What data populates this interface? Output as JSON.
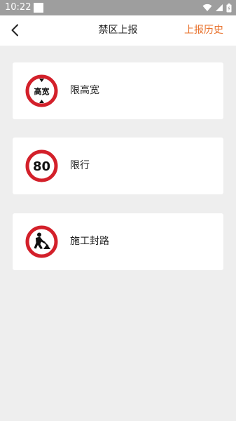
{
  "status_bar": {
    "time": "10:22",
    "icons": [
      "notification-square-icon",
      "wifi-icon",
      "cell-signal-icon",
      "battery-charging-icon"
    ]
  },
  "header": {
    "title": "禁区上报",
    "history_label": "上报历史",
    "back_icon": "chevron-left-icon"
  },
  "colors": {
    "accent": "#e8702a",
    "sign_red": "#d3202a",
    "status_bar_bg": "#9e9e9e",
    "page_bg": "#eeeeee"
  },
  "cards": [
    {
      "label": "限高宽",
      "icon": "height-width-limit-sign-icon",
      "sign_text": "高宽"
    },
    {
      "label": "限行",
      "icon": "speed-limit-sign-icon",
      "sign_text": "80"
    },
    {
      "label": "施工封路",
      "icon": "road-work-sign-icon"
    }
  ]
}
